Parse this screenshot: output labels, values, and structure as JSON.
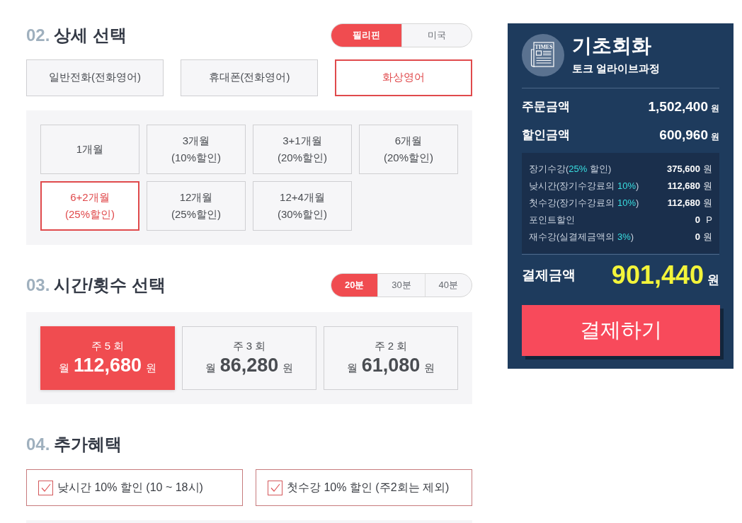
{
  "detail_section": {
    "number": "02.",
    "title": "상세 선택",
    "country_tabs": [
      {
        "label": "필리핀",
        "selected": true
      },
      {
        "label": "미국",
        "selected": false
      }
    ],
    "course_types": [
      {
        "label": "일반전화(전화영어)",
        "selected": false
      },
      {
        "label": "휴대폰(전화영어)",
        "selected": false
      },
      {
        "label": "화상영어",
        "selected": true
      }
    ],
    "periods": [
      {
        "lines": [
          "1개월"
        ],
        "selected": false
      },
      {
        "lines": [
          "3개월",
          "(10%할인)"
        ],
        "selected": false
      },
      {
        "lines": [
          "3+1개월",
          "(20%할인)"
        ],
        "selected": false
      },
      {
        "lines": [
          "6개월",
          "(20%할인)"
        ],
        "selected": false
      },
      {
        "lines": [
          "6+2개월",
          "(25%할인)"
        ],
        "selected": true
      },
      {
        "lines": [
          "12개월",
          "(25%할인)"
        ],
        "selected": false
      },
      {
        "lines": [
          "12+4개월",
          "(30%할인)"
        ],
        "selected": false
      }
    ]
  },
  "time_section": {
    "number": "03.",
    "title": "시간/횟수 선택",
    "duration_tabs": [
      {
        "label": "20분",
        "selected": true
      },
      {
        "label": "30분",
        "selected": false
      },
      {
        "label": "40분",
        "selected": false
      }
    ],
    "frequencies": [
      {
        "label": "주 5 회",
        "prefix": "월",
        "price": "112,680",
        "unit": "원",
        "selected": true
      },
      {
        "label": "주 3 회",
        "prefix": "월",
        "price": "86,280",
        "unit": "원",
        "selected": false
      },
      {
        "label": "주 2 회",
        "prefix": "월",
        "price": "61,080",
        "unit": "원",
        "selected": false
      }
    ]
  },
  "benefits_section": {
    "number": "04.",
    "title": "추가혜택",
    "options": [
      {
        "label": "낮시간 10% 할인 (10 ~ 18시)",
        "checked": true
      },
      {
        "label": "첫수강 10% 할인 (주2회는 제외)",
        "checked": true
      }
    ]
  },
  "summary": {
    "icon_text": "TIMES",
    "title": "기초회화",
    "subtitle": "토크 얼라이브과정",
    "totals": [
      {
        "label": "주문금액",
        "value": "1,502,400",
        "unit": "원"
      },
      {
        "label": "할인금액",
        "value": "600,960",
        "unit": "원"
      }
    ],
    "discounts": [
      {
        "label": [
          {
            "text": "장기수강(",
            "highlight": false
          },
          {
            "text": "25%",
            "highlight": true
          },
          {
            "text": " 할인)",
            "highlight": false
          }
        ],
        "value": "375,600",
        "unit": "원"
      },
      {
        "label": [
          {
            "text": "낮시간(장기수강료의 ",
            "highlight": false
          },
          {
            "text": "10%",
            "highlight": true
          },
          {
            "text": ")",
            "highlight": false
          }
        ],
        "value": "112,680",
        "unit": "원"
      },
      {
        "label": [
          {
            "text": "첫수강(장기수강료의 ",
            "highlight": false
          },
          {
            "text": "10%",
            "highlight": true
          },
          {
            "text": ")",
            "highlight": false
          }
        ],
        "value": "112,680",
        "unit": "원"
      },
      {
        "label": [
          {
            "text": "포인트할인",
            "highlight": false
          }
        ],
        "value": "0",
        "unit": "P"
      },
      {
        "label": [
          {
            "text": "재수강(실결제금액의 ",
            "highlight": false
          },
          {
            "text": "3%",
            "highlight": true
          },
          {
            "text": ")",
            "highlight": false
          }
        ],
        "value": "0",
        "unit": "원"
      }
    ],
    "payment": {
      "label": "결제금액",
      "value": "901,440",
      "unit": "원"
    },
    "pay_button": "결제하기"
  }
}
